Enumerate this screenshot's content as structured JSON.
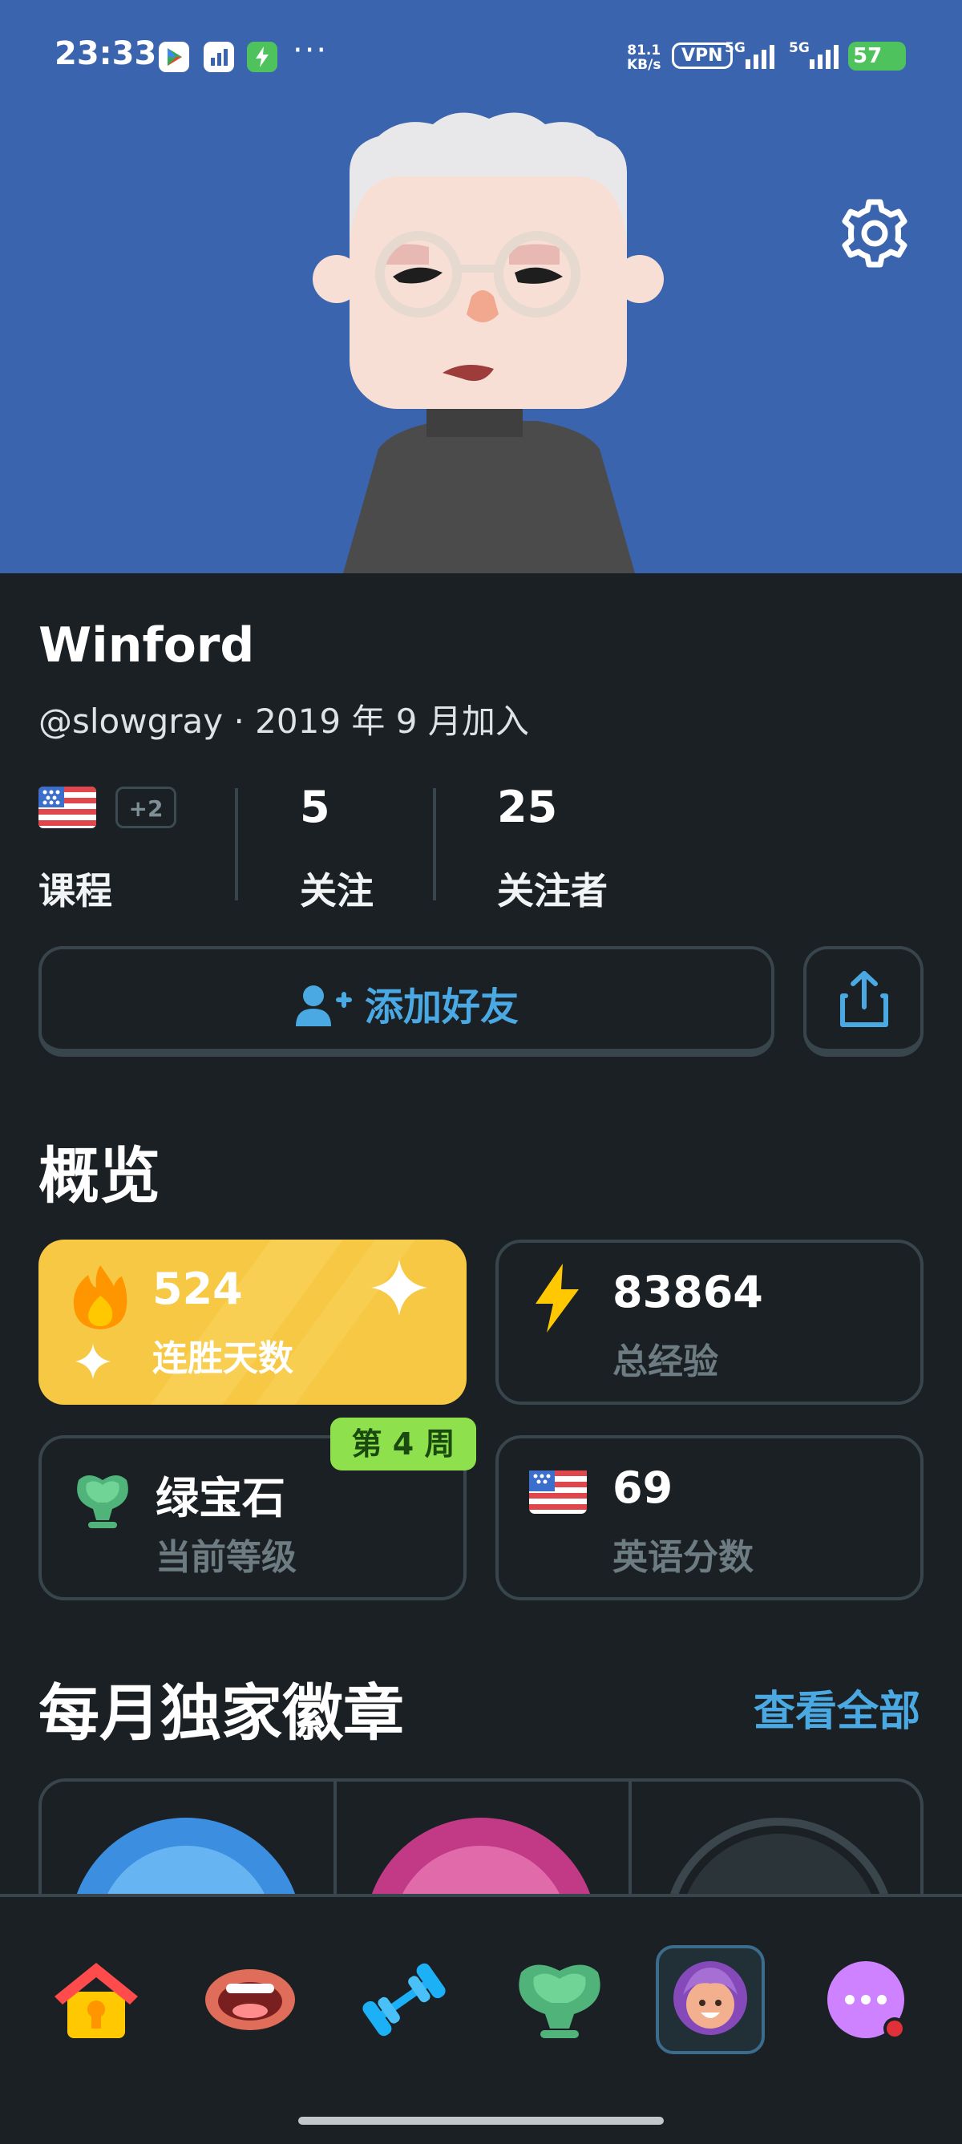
{
  "status_bar": {
    "time": "23:33",
    "more": "···",
    "net_speed_value": "81.1",
    "net_speed_unit": "KB/s",
    "vpn": "VPN",
    "sig1": "5G",
    "sig2": "5G",
    "battery": "57"
  },
  "profile": {
    "name": "Winford",
    "subtitle": "@slowgray · 2019 年 9 月加入",
    "courses_label": "课程",
    "courses_extra": "+2",
    "following_count": "5",
    "following_label": "关注",
    "followers_count": "25",
    "followers_label": "关注者"
  },
  "actions": {
    "add_friend": "添加好友"
  },
  "overview": {
    "title": "概览",
    "streak_value": "524",
    "streak_label": "连胜天数",
    "xp_value": "83864",
    "xp_label": "总经验",
    "league_name": "绿宝石",
    "league_label": "当前等级",
    "league_week": "第 4 周",
    "score_value": "69",
    "score_label": "英语分数"
  },
  "badges": {
    "title": "每月独家徽章",
    "see_all": "查看全部"
  },
  "nav": {
    "icons": [
      "home-icon",
      "speak-icon",
      "practice-icon",
      "league-icon",
      "profile-icon",
      "more-icon"
    ]
  },
  "colors": {
    "hero_bg": "#3a64ad",
    "page_bg": "#1a2023",
    "accent_blue": "#4aa8e2",
    "streak_gold": "#f7c843",
    "week_badge": "#8ee14d"
  }
}
